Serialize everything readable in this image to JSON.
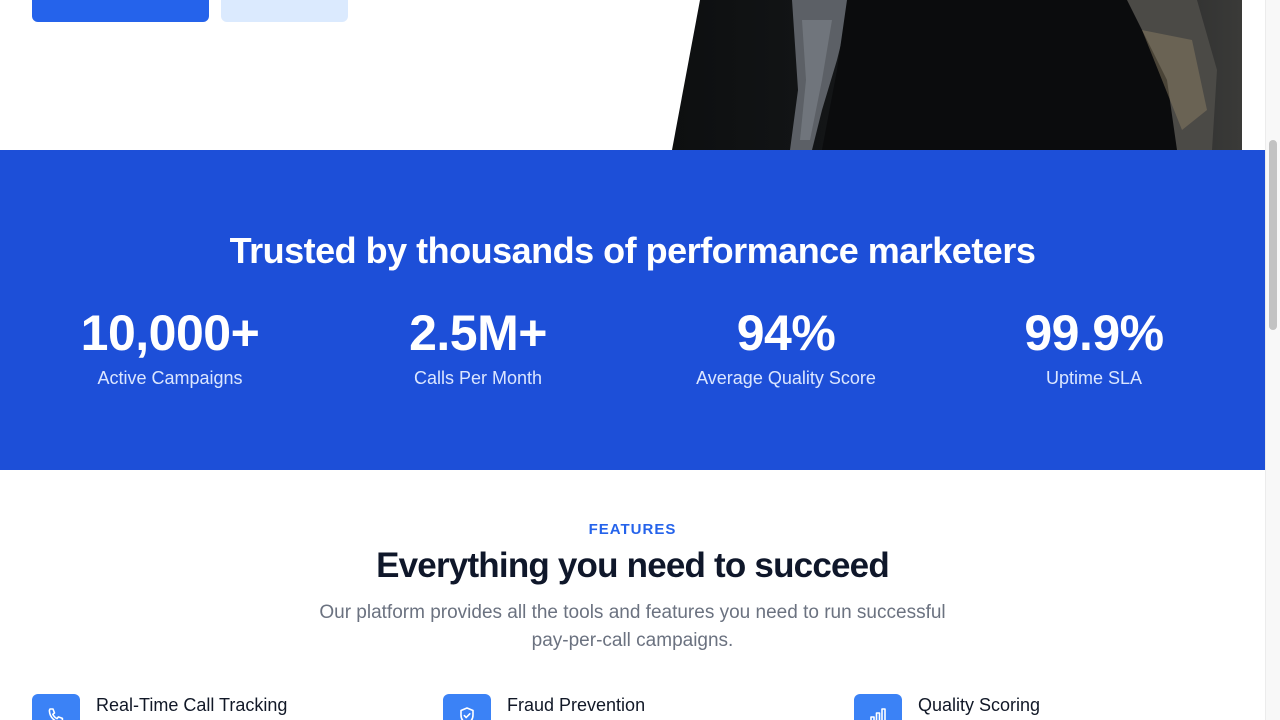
{
  "hero": {
    "primary_button_label": "",
    "secondary_button_label": ""
  },
  "stats": {
    "title": "Trusted by thousands of performance marketers",
    "items": [
      {
        "value": "10,000+",
        "label": "Active Campaigns"
      },
      {
        "value": "2.5M+",
        "label": "Calls Per Month"
      },
      {
        "value": "94%",
        "label": "Average Quality Score"
      },
      {
        "value": "99.9%",
        "label": "Uptime SLA"
      }
    ]
  },
  "features": {
    "eyebrow": "FEATURES",
    "title": "Everything you need to succeed",
    "subtitle_line1": "Our platform provides all the tools and features you need to run successful",
    "subtitle_line2": "pay-per-call campaigns.",
    "items": [
      {
        "title": "Real-Time Call Tracking",
        "icon": "phone-icon"
      },
      {
        "title": "Fraud Prevention",
        "icon": "shield-check-icon"
      },
      {
        "title": "Quality Scoring",
        "icon": "bar-chart-icon"
      }
    ]
  },
  "colors": {
    "brand_blue": "#1d4fd8",
    "primary_button": "#2563eb",
    "secondary_button": "#dbeafe",
    "accent_text": "#2563eb",
    "heading_dark": "#0f172a",
    "muted_text": "#6b7280"
  }
}
